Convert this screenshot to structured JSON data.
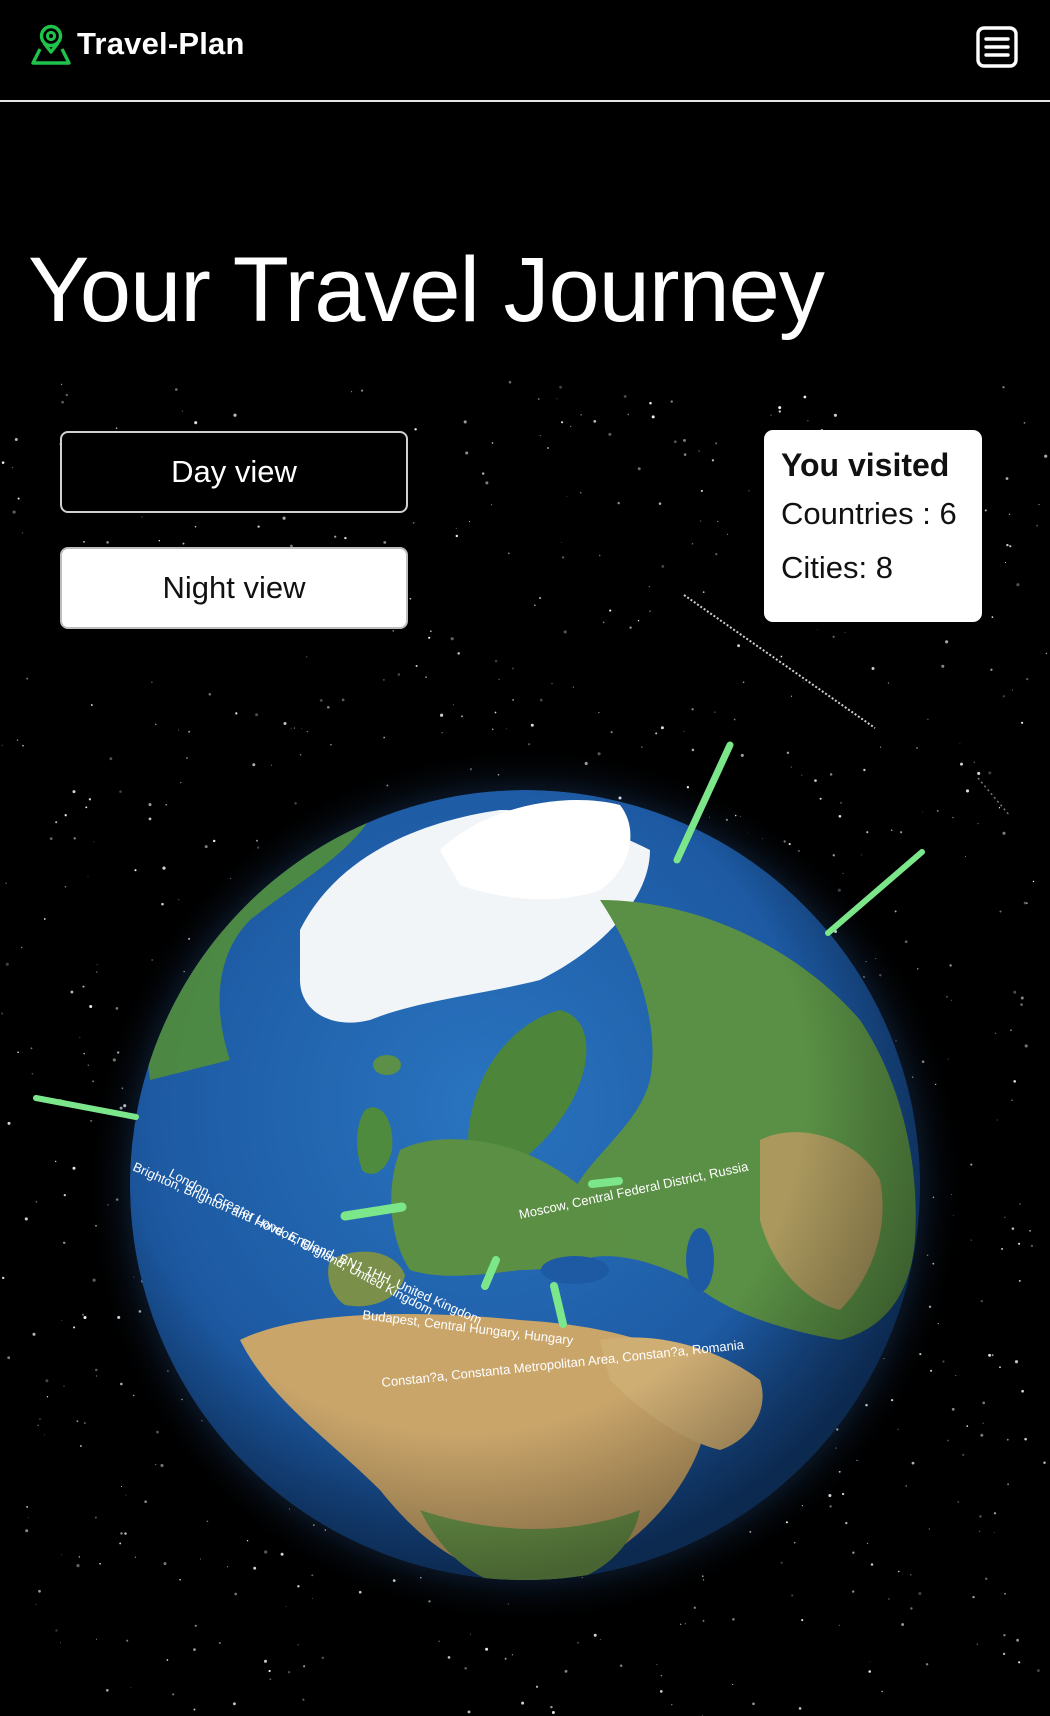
{
  "navbar": {
    "brand_name": "Travel-Plan",
    "brand_icon": "map-pin-person-icon",
    "menu_icon": "hamburger-menu-icon"
  },
  "page": {
    "title": "Your Travel Journey"
  },
  "view_toggle": {
    "day_label": "Day view",
    "night_label": "Night view"
  },
  "visited": {
    "heading": "You visited",
    "countries_label": "Countries : 6",
    "cities_label": "Cities: 8"
  },
  "globe": {
    "locations": [
      "London, Greater London, England, United Kingdom",
      "Brighton, Brighton and Hove, England, BN1 1HH, United Kingdom",
      "Moscow, Central Federal District, Russia",
      "Budapest, Central Hungary, Hungary",
      "Constan?a, Constanta Metropolitan Area, Constan?a, Romania"
    ],
    "marker_color": "#7ce68a"
  },
  "colors": {
    "background": "#000000",
    "brand_accent": "#1fc24a",
    "ocean": "#1f5fa8",
    "land_green": "#4f8b3e",
    "land_desert": "#c9a56a",
    "ice": "#f2f5f8"
  }
}
